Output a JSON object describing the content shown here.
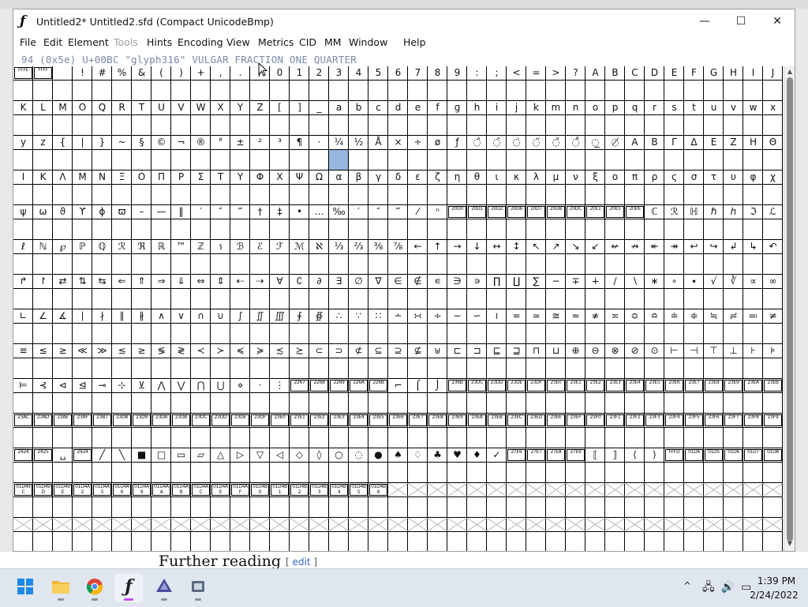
{
  "window": {
    "title": "Untitled2*  Untitled2.sfd (Compact UnicodeBmp)",
    "app_icon": "fontforge-icon",
    "min_glyph": "—",
    "max_glyph": "☐",
    "close_glyph": "✕"
  },
  "menu": [
    "File",
    "Edit",
    "Element",
    "Tools",
    "Hints",
    "Encoding",
    "View",
    "Metrics",
    "CID",
    "MM",
    "Window",
    "Help"
  ],
  "menu_disabled": [
    "Tools"
  ],
  "status_line": "94 (0x5e) U+00BC \"glyph316\" VULGAR FRACTION ONE QUARTER",
  "grid": {
    "columns": 39,
    "selected": {
      "row": 2,
      "col": 16
    },
    "rows": [
      [
        "FFFE",
        "FFFF",
        "",
        "!",
        "#",
        "%",
        "&",
        "(",
        ")",
        "+",
        ",",
        ".",
        "/",
        "0",
        "1",
        "2",
        "3",
        "4",
        "5",
        "6",
        "7",
        "8",
        "9",
        ":",
        ";",
        "<",
        "=",
        ">",
        "?",
        "A",
        "B",
        "C",
        "D",
        "E",
        "F",
        "G",
        "H",
        "I",
        "J"
      ],
      [
        "K",
        "L",
        "M",
        "O",
        "Q",
        "R",
        "T",
        "U",
        "V",
        "W",
        "X",
        "Y",
        "Z",
        "[",
        "]",
        "_",
        "a",
        "b",
        "c",
        "d",
        "e",
        "f",
        "g",
        "h",
        "i",
        "j",
        "k",
        "m",
        "n",
        "o",
        "p",
        "q",
        "r",
        "s",
        "t",
        "u",
        "v",
        "w",
        "x"
      ],
      [
        "y",
        "z",
        "{",
        "|",
        "}",
        "~",
        "§",
        "©",
        "¬",
        "®",
        "°",
        "±",
        "²",
        "³",
        "¶",
        "·",
        "¼",
        "½",
        "Å",
        "×",
        "÷",
        "ø",
        "ƒ",
        "◌̂",
        "◌̄",
        "◌̇",
        "◌̈",
        "◌̌",
        "◌̊",
        "◌̲",
        "◌̸",
        "Α",
        "Β",
        "Γ",
        "Δ",
        "Ε",
        "Ζ",
        "Η",
        "Θ"
      ],
      [
        "Ι",
        "Κ",
        "Λ",
        "Μ",
        "Ν",
        "Ξ",
        "Ο",
        "Π",
        "Ρ",
        "Σ",
        "Τ",
        "Υ",
        "Φ",
        "Χ",
        "Ψ",
        "Ω",
        "α",
        "β",
        "γ",
        "δ",
        "ε",
        "ζ",
        "η",
        "θ",
        "ι",
        "κ",
        "λ",
        "μ",
        "ν",
        "ξ",
        "ο",
        "π",
        "ρ",
        "ς",
        "σ",
        "τ",
        "υ",
        "φ",
        "χ"
      ],
      [
        "ψ",
        "ω",
        "ϑ",
        "ϒ",
        "ϕ",
        "ϖ",
        "–",
        "—",
        "‖",
        "′",
        "″",
        "‴",
        "†",
        "‡",
        "•",
        "…",
        "‰",
        "′",
        "″",
        "‴",
        "⁄",
        "ⁿ",
        "20D0",
        "20D1",
        "20D2",
        "20D6",
        "20D7",
        "20DB",
        "20DC",
        "20E1",
        "20E5",
        "20E6",
        "ℂ",
        "ℛ",
        "ℍ",
        "ℏ",
        "ℎ",
        "ℑ",
        "ℒ"
      ],
      [
        "ℓ",
        "ℕ",
        "℘",
        "ℙ",
        "ℚ",
        "ℛ",
        "ℜ",
        "ℝ",
        "™",
        "ℤ",
        "℩",
        "ℬ",
        "ℰ",
        "ℱ",
        "ℳ",
        "ℵ",
        "⅓",
        "⅔",
        "⅜",
        "⅞",
        "←",
        "↑",
        "→",
        "↓",
        "↔",
        "↕",
        "↖",
        "↗",
        "↘",
        "↙",
        "↚",
        "↛",
        "↞",
        "↠",
        "↩",
        "↪",
        "↲",
        "↳",
        "↶"
      ],
      [
        "↱",
        "↾",
        "⇄",
        "⇅",
        "⇆",
        "⇐",
        "⇑",
        "⇒",
        "⇓",
        "⇔",
        "⇕",
        "⇠",
        "⇢",
        "∀",
        "∁",
        "∂",
        "∃",
        "∅",
        "∇",
        "∈",
        "∉",
        "∊",
        "∋",
        "∍",
        "∏",
        "∐",
        "∑",
        "−",
        "∓",
        "∔",
        "∕",
        "∖",
        "∗",
        "∘",
        "∙",
        "√",
        "∛",
        "∝",
        "∞"
      ],
      [
        "∟",
        "∠",
        "∡",
        "∣",
        "∤",
        "∥",
        "∦",
        "∧",
        "∨",
        "∩",
        "∪",
        "∫",
        "∬",
        "∭",
        "∮",
        "∯",
        "∴",
        "∵",
        "∷",
        "∸",
        "∺",
        "∻",
        "∼",
        "∽",
        "≀",
        "≂",
        "≃",
        "≅",
        "≈",
        "≉",
        "≍",
        "≎",
        "≏",
        "≐",
        "≑",
        "≒",
        "≓",
        "≕",
        "≠"
      ],
      [
        "≡",
        "≤",
        "≥",
        "≪",
        "≫",
        "≲",
        "≳",
        "≶",
        "≷",
        "≺",
        "≻",
        "≼",
        "≽",
        "≾",
        "≿",
        "⊂",
        "⊃",
        "⊄",
        "⊆",
        "⊇",
        "⊈",
        "⊎",
        "⊏",
        "⊐",
        "⊑",
        "⊒",
        "⊓",
        "⊔",
        "⊕",
        "⊖",
        "⊗",
        "⊘",
        "⊙",
        "⊢",
        "⊣",
        "⊤",
        "⊥",
        "⊦",
        "⊧"
      ],
      [
        "⊨",
        "⊰",
        "⊲",
        "⊴",
        "⊸",
        "⊹",
        "⊻",
        "⋀",
        "⋁",
        "⋂",
        "⋃",
        "⋄",
        "⋅",
        "⋮",
        "2267",
        "2268",
        "2269",
        "226A",
        "226B",
        "⌐",
        "⌠",
        "⌡",
        "236B",
        "23DC",
        "23DD",
        "23DE",
        "23DF",
        "23E0",
        "23E1",
        "23E2",
        "23E3",
        "23E4",
        "23E5",
        "23E6",
        "23E7",
        "23E8",
        "23E9",
        "23EA",
        "23EB"
      ],
      [
        "23AC",
        "23AD",
        "23AE",
        "23AF",
        "23B7",
        "23D8",
        "23D9",
        "23DA",
        "23DB",
        "23DC",
        "23DD",
        "23DE",
        "23DF",
        "23E0",
        "23E1",
        "23E2",
        "23E3",
        "23E4",
        "23E5",
        "23E6",
        "23E7",
        "23E8",
        "23E9",
        "23EA",
        "23EB",
        "23EC",
        "23ED",
        "23EE",
        "23EF",
        "23F0",
        "23F1",
        "23F2",
        "23F3",
        "23F4",
        "23F5",
        "23F6",
        "23F7",
        "23F8",
        "23F9"
      ],
      [
        "2424",
        "2425",
        "␣",
        "2424",
        "╱",
        "╲",
        "■",
        "□",
        "▭",
        "▱",
        "△",
        "▷",
        "▽",
        "◁",
        "◇",
        "◊",
        "○",
        "◌",
        "●",
        "♠",
        "♢",
        "♣",
        "♥",
        "♦",
        "✓",
        "27E6",
        "27E7",
        "27E8",
        "27E9",
        "⟦",
        "⟧",
        "⟨",
        "⟩",
        "FFFD",
        "01D4",
        "01D5",
        "01D6",
        "01D7",
        "01D8"
      ]
    ],
    "partial_row_codes": [
      "01D49C",
      "01D49D",
      "01D49E",
      "01D4A2",
      "01D4A5",
      "01D4A6",
      "01D4A9",
      "01D4AA",
      "01D4AB",
      "01D4AC",
      "01D4AE",
      "01D4AF",
      "01D4B0",
      "01D4B1",
      "01D4B2",
      "01D4B3",
      "01D4B4",
      "01D4B5",
      "01D4B6",
      "01D4B7",
      "01D4B8",
      "01D4B9",
      "01D4BB",
      "01D4BD",
      "01D4BE",
      "01D4BF",
      "01D4C0",
      "01D4C1",
      "01D4C2",
      "01D4C3",
      "01D4C5",
      "01D4C6",
      "01D4C7",
      "01D4C8",
      "01D4C9",
      "01D4CA",
      "01D4CB",
      "01D4CC",
      "01D4CD"
    ],
    "partial_row_filled": 19
  },
  "background_page": {
    "heading": "Further reading",
    "edit_link": "edit"
  },
  "taskbar": {
    "apps": [
      {
        "name": "start-button",
        "icon": "windows-start-icon",
        "color": "#1e88e5",
        "active": false,
        "dot": false
      },
      {
        "name": "taskbar-file-explorer",
        "icon": "folder-icon",
        "color": "#f2b632",
        "active": false,
        "dot": true
      },
      {
        "name": "taskbar-chrome",
        "icon": "chrome-icon",
        "color": "#db4437",
        "active": false,
        "dot": true
      },
      {
        "name": "taskbar-fontforge",
        "icon": "fontforge-icon",
        "color": "#222222",
        "active": true,
        "dot": true
      },
      {
        "name": "taskbar-inkscape",
        "icon": "inkscape-icon",
        "color": "#4a4a9a",
        "active": false,
        "dot": true
      },
      {
        "name": "taskbar-app",
        "icon": "app-icon",
        "color": "#5a6b80",
        "active": false,
        "dot": true
      }
    ],
    "tray_chevron": "^",
    "tray_icons": [
      "network-icon",
      "speaker-icon",
      "battery-icon"
    ],
    "time": "1:39 PM",
    "date": "2/24/2022"
  },
  "colors": {
    "selected_cell": "#95b7e0",
    "status_text": "#7a8aa6",
    "menu_disabled": "#a0a0a0"
  }
}
